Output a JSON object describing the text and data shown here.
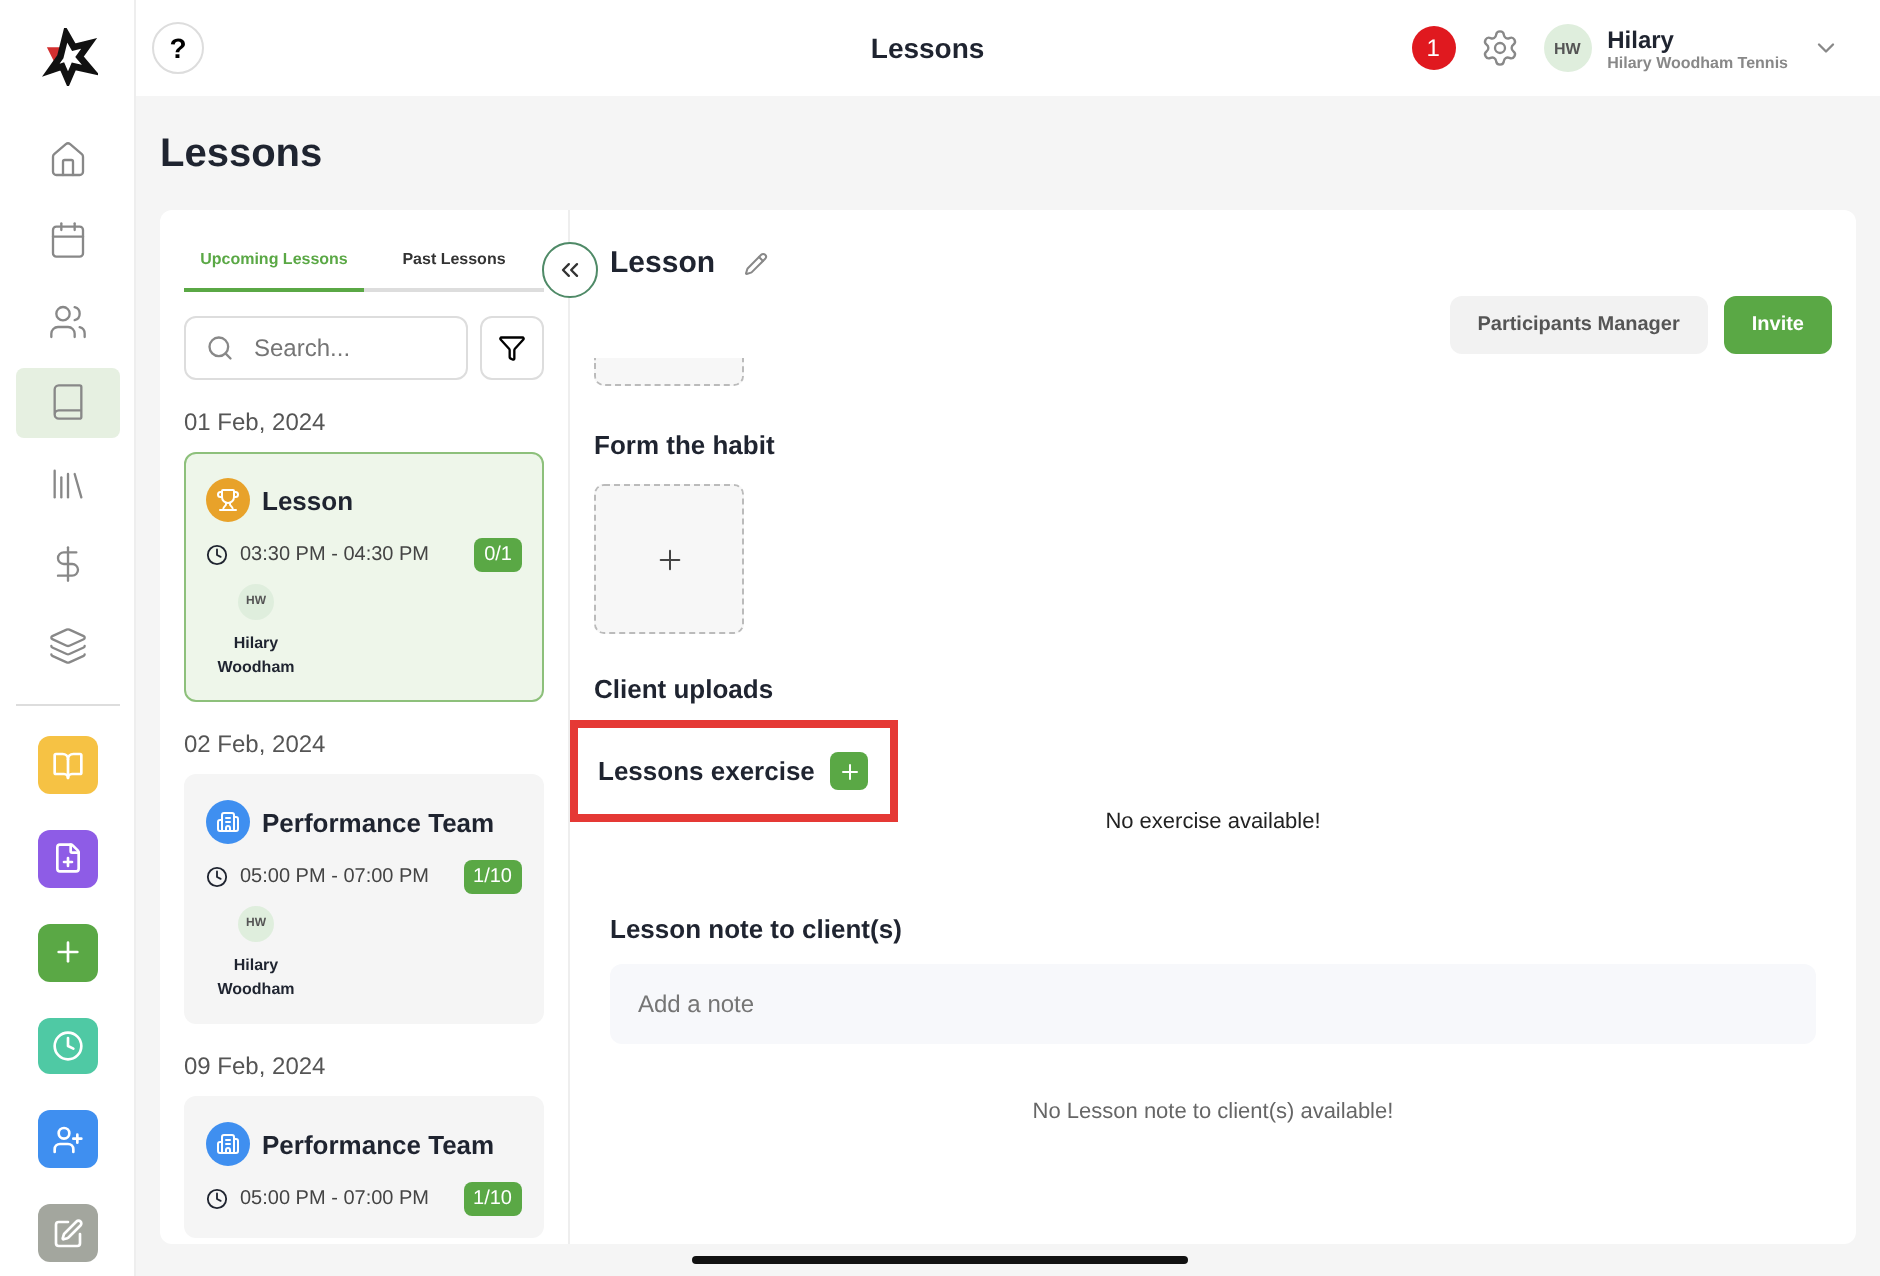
{
  "topbar": {
    "help": "?",
    "title": "Lessons",
    "notifications": "1",
    "user": {
      "initials": "HW",
      "name": "Hilary",
      "org": "Hilary Woodham Tennis"
    }
  },
  "rail": [
    {
      "kind": "nav",
      "selected": false
    },
    {
      "kind": "nav",
      "selected": false
    },
    {
      "kind": "nav",
      "selected": false
    },
    {
      "kind": "nav",
      "selected": true
    },
    {
      "kind": "nav",
      "selected": false
    },
    {
      "kind": "nav",
      "selected": false
    },
    {
      "kind": "nav",
      "selected": false
    },
    {
      "kind": "action",
      "color": "#f6c244"
    },
    {
      "kind": "action",
      "color": "#8e5ce6"
    },
    {
      "kind": "action",
      "color": "#5aa845"
    },
    {
      "kind": "action",
      "color": "#4fc9a4"
    },
    {
      "kind": "action",
      "color": "#3f8ff0"
    },
    {
      "kind": "action",
      "color": "#a3a69e"
    }
  ],
  "page_title": "Lessons",
  "tabs": [
    {
      "label": "Upcoming Lessons",
      "selected": true
    },
    {
      "label": "Past Lessons",
      "selected": false
    }
  ],
  "search": {
    "placeholder": "Search..."
  },
  "groups": [
    {
      "date": "01 Feb, 2024",
      "lessons": [
        {
          "kind": "trophy",
          "name": "Lesson",
          "time": "03:30 PM - 04:30 PM",
          "count": "0/1",
          "selected": true,
          "participants": [
            {
              "initials": "HW",
              "name": "Hilary Woodham"
            }
          ]
        }
      ]
    },
    {
      "date": "02 Feb, 2024",
      "lessons": [
        {
          "kind": "team",
          "name": "Performance Team",
          "time": "05:00 PM - 07:00 PM",
          "count": "1/10",
          "selected": false,
          "participants": [
            {
              "initials": "HW",
              "name": "Hilary Woodham"
            }
          ]
        }
      ]
    },
    {
      "date": "09 Feb, 2024",
      "lessons": [
        {
          "kind": "team",
          "name": "Performance Team",
          "time": "05:00 PM - 07:00 PM",
          "count": "1/10",
          "selected": false
        }
      ]
    }
  ],
  "detail": {
    "title": "Lesson",
    "buttons": [
      {
        "label": "Participants Manager",
        "kind": "secondary"
      },
      {
        "label": "Invite",
        "kind": "primary"
      }
    ],
    "sections": [
      {
        "title": "Form the habit",
        "kind": "upload"
      },
      {
        "title": "Client uploads",
        "kind": "plain"
      },
      {
        "title": "Lessons exercise",
        "kind": "add",
        "highlighted": true,
        "empty": "No exercise available!"
      }
    ],
    "note": {
      "title": "Lesson note to client(s)",
      "placeholder": "Add a note",
      "empty": "No Lesson note to client(s) available!"
    }
  }
}
